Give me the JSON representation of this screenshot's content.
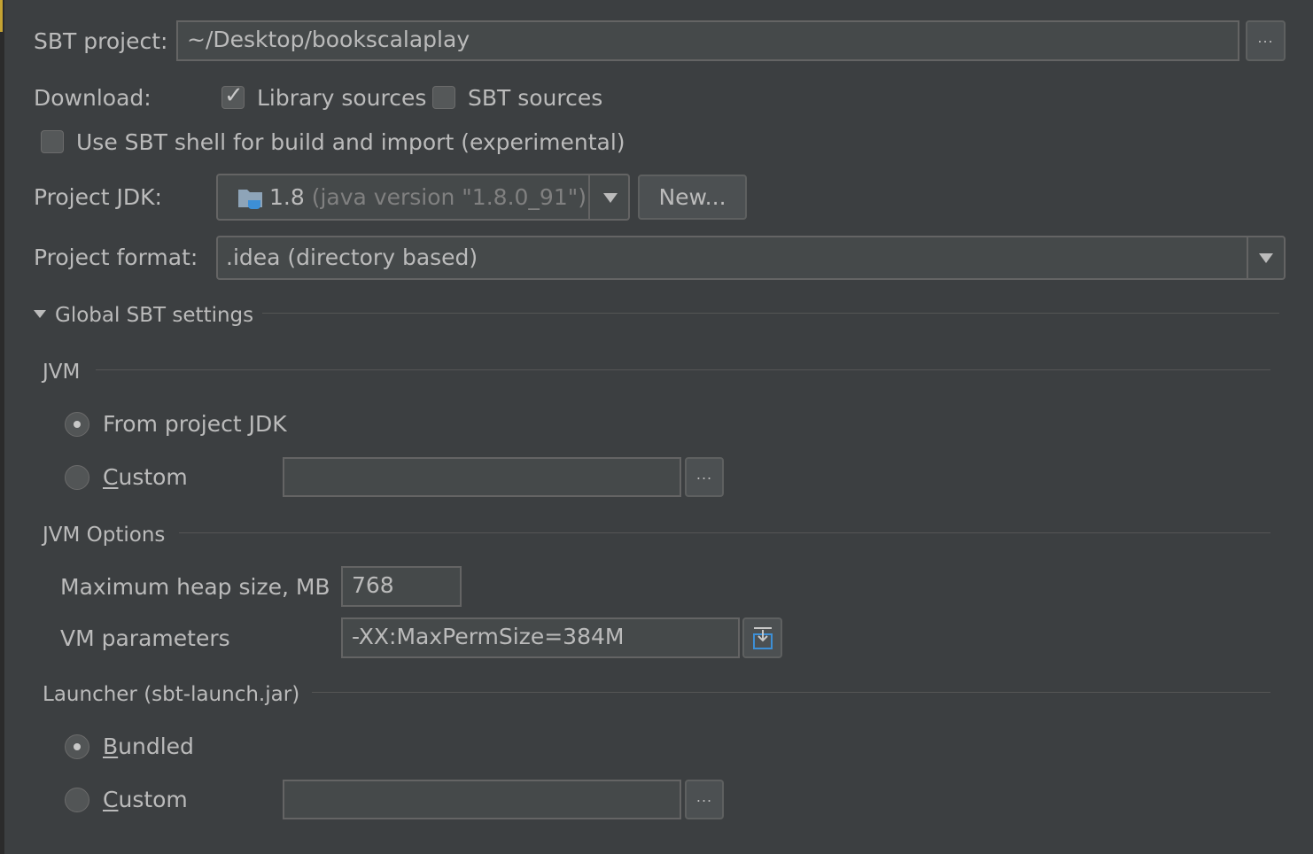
{
  "sbt_project": {
    "label": "SBT project:",
    "value": "~/Desktop/bookscalaplay",
    "browse_label": "..."
  },
  "download": {
    "label": "Download:",
    "library_sources": {
      "label": "Library sources",
      "checked": true
    },
    "sbt_sources": {
      "label": "SBT sources",
      "checked": false
    }
  },
  "use_sbt_shell": {
    "label": "Use SBT shell for build and import (experimental)",
    "checked": false
  },
  "project_jdk": {
    "label": "Project JDK:",
    "version": "1.8",
    "detail": "(java version \"1.8.0_91\")",
    "new_label": "New..."
  },
  "project_format": {
    "label": "Project format:",
    "value": ".idea (directory based)"
  },
  "global_sbt": {
    "title": "Global SBT settings",
    "jvm": {
      "title": "JVM",
      "from_project_jdk": {
        "label": "From project JDK",
        "selected": true
      },
      "custom": {
        "label_mnemonic": "C",
        "label_rest": "ustom",
        "value": "",
        "browse_label": "..."
      }
    },
    "jvm_options": {
      "title": "JVM Options",
      "max_heap": {
        "label": "Maximum heap size, MB",
        "value": "768"
      },
      "vm_params": {
        "label": "VM parameters",
        "value": "-XX:MaxPermSize=384M"
      }
    },
    "launcher": {
      "title": "Launcher (sbt-launch.jar)",
      "bundled": {
        "label_mnemonic": "B",
        "label_rest": "undled",
        "selected": true
      },
      "custom": {
        "label_mnemonic": "C",
        "label_rest": "ustom",
        "value": "",
        "browse_label": "..."
      }
    }
  },
  "colors": {
    "background": "#3c3f41",
    "field": "#45494a",
    "text": "#bbbbbb",
    "accent": "#3d8fd6"
  }
}
